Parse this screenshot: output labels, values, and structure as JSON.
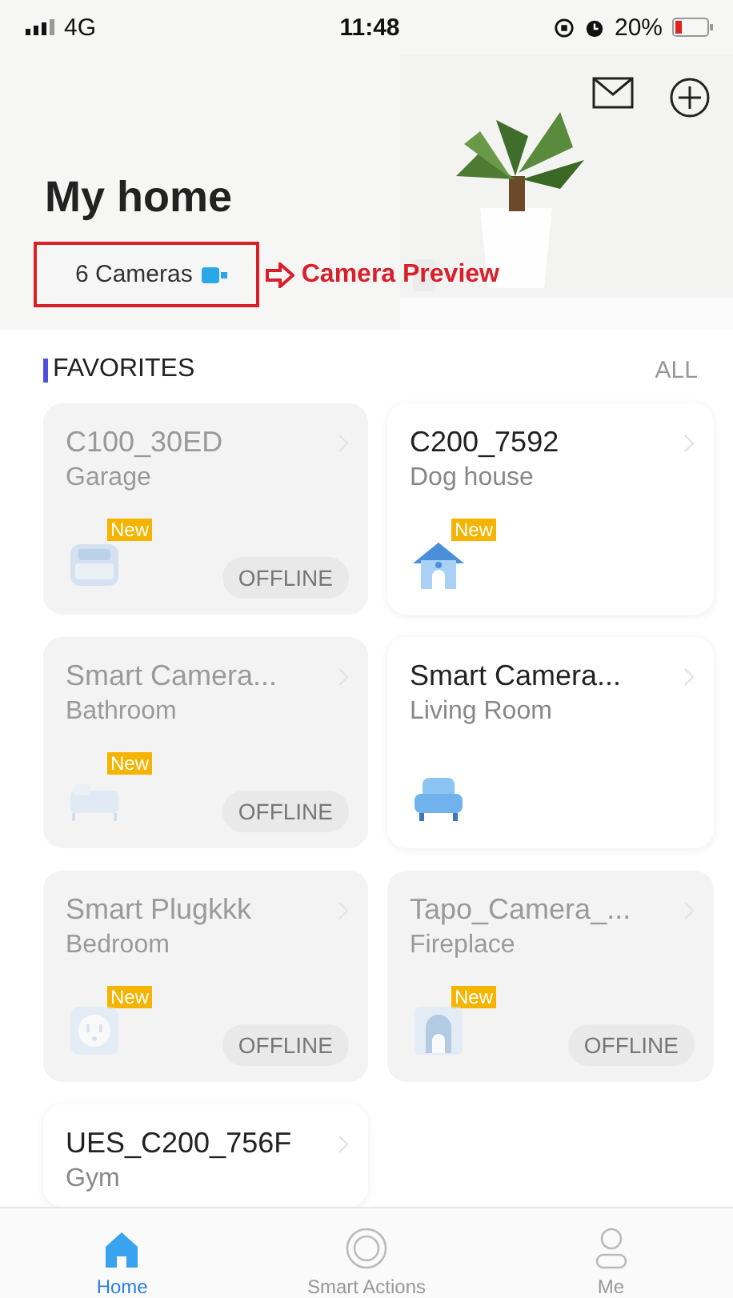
{
  "status_bar": {
    "network": "4G",
    "time": "11:48",
    "battery": "20%"
  },
  "header": {
    "title": "My home",
    "cameras_chip": "6 Cameras",
    "annotation": "Camera Preview"
  },
  "favorites": {
    "title": "FAVORITES",
    "all_link": "ALL"
  },
  "devices": [
    {
      "name": "C100_30ED",
      "room": "Garage",
      "badge": "New",
      "offline": true,
      "status": "OFFLINE"
    },
    {
      "name": "C200_7592",
      "room": "Dog house",
      "badge": "New",
      "offline": false
    },
    {
      "name": "Smart Camera...",
      "room": "Bathroom",
      "badge": "New",
      "offline": true,
      "status": "OFFLINE"
    },
    {
      "name": "Smart Camera...",
      "room": "Living Room",
      "offline": false
    },
    {
      "name": "Smart Plugkkk",
      "room": "Bedroom",
      "badge": "New",
      "offline": true,
      "status": "OFFLINE"
    },
    {
      "name": "Tapo_Camera_...",
      "room": "Fireplace",
      "badge": "New",
      "offline": true,
      "status": "OFFLINE"
    },
    {
      "name": "UES_C200_756F",
      "room": "Gym",
      "offline": false
    }
  ],
  "tab_bar": [
    {
      "label": "Home",
      "selected": true
    },
    {
      "label": "Smart Actions",
      "selected": false
    },
    {
      "label": "Me",
      "selected": false
    }
  ]
}
